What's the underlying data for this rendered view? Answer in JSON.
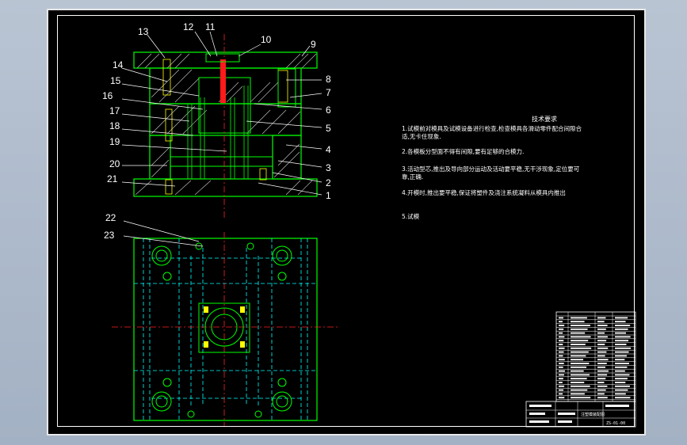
{
  "colors": {
    "background": "#a9b6c8",
    "sheet": "#000000",
    "outline": "#00ff00",
    "hatch": "#ffffff",
    "hidden_line": "#00ffff",
    "center_line": "#ff2020",
    "dimension": "#ffff00",
    "leader": "#ffffff"
  },
  "callouts": [
    "1",
    "2",
    "3",
    "4",
    "5",
    "6",
    "7",
    "8",
    "9",
    "10",
    "11",
    "12",
    "13",
    "14",
    "15",
    "16",
    "17",
    "18",
    "19",
    "20",
    "21",
    "22",
    "23"
  ],
  "tech_requirements": {
    "title": "技术要求",
    "items": [
      "1.试模前对模具及试模设备进行检查,检查模具各滑动零件配合间隙合适,无卡住现象.",
      "2.各模板分型面不得有间隙,要有足够的合模力.",
      "3.活动型芯,推出及导向部分运动及活动要平稳,无干涉现象,定位要可靠,正确.",
      "4.开模时,推出要平稳,保证将塑件及浇注系统凝料从模具内推出",
      "5.试模"
    ]
  },
  "title_block": {
    "drawing_name": "注塑模装配图",
    "drawing_no": "ZS-01-00"
  },
  "icons": [
    "assembly-section-view",
    "plan-view",
    "parts-list-table",
    "title-block"
  ]
}
